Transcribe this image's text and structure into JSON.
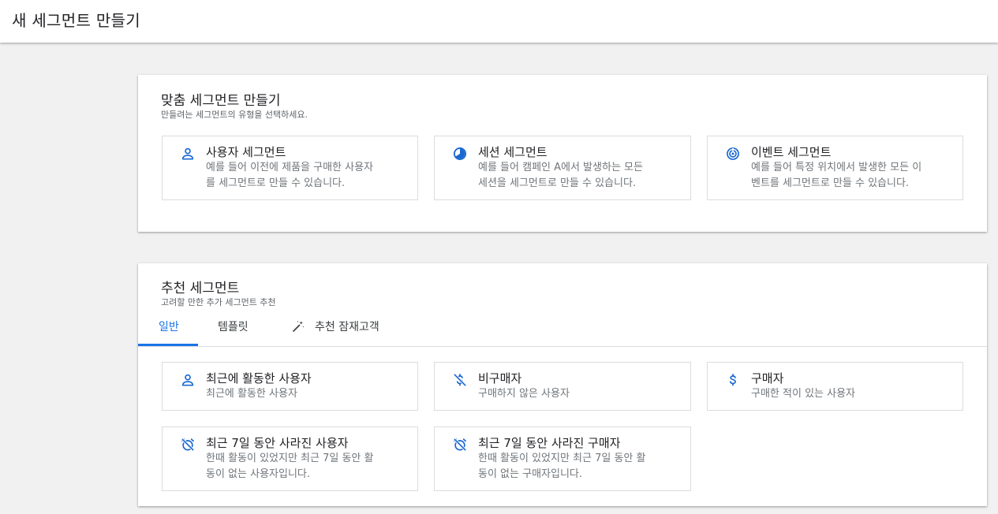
{
  "header": {
    "title": "새 세그먼트 만들기"
  },
  "custom": {
    "title": "맞춤 세그먼트 만들기",
    "subtitle": "만들려는 세그먼트의 유형을 선택하세요.",
    "options": [
      {
        "icon": "person-icon",
        "title": "사용자 세그먼트",
        "desc": "예를 들어 이전에 제품을 구매한 사용자\n를 세그먼트로 만들 수 있습니다."
      },
      {
        "icon": "session-icon",
        "title": "세션 세그먼트",
        "desc": "예를 들어 캠페인 A에서 발생하는 모든\n세션을 세그먼트로 만들 수 있습니다."
      },
      {
        "icon": "event-icon",
        "title": "이벤트 세그먼트",
        "desc": "예를 들어 특정 위치에서 발생한 모든 이\n벤트를 세그먼트로 만들 수 있습니다."
      }
    ]
  },
  "suggested": {
    "title": "추천 세그먼트",
    "subtitle": "고려할 만한 추가 세그먼트 추천",
    "tabs": [
      {
        "label": "일반",
        "active": true
      },
      {
        "label": "템플릿",
        "active": false
      },
      {
        "label": "추천 잠재고객",
        "active": false,
        "icon": "magic-wand-icon"
      }
    ],
    "options": [
      {
        "icon": "person-icon",
        "title": "최근에 활동한 사용자",
        "desc": "최근에 활동한 사용자"
      },
      {
        "icon": "no-dollar-icon",
        "title": "비구매자",
        "desc": "구매하지 않은 사용자"
      },
      {
        "icon": "dollar-icon",
        "title": "구매자",
        "desc": "구매한 적이 있는 사용자"
      },
      {
        "icon": "alarm-off-icon",
        "title": "최근 7일 동안 사라진 사용자",
        "desc": "한때 활동이 있었지만 최근 7일 동안 활\n동이 없는 사용자입니다."
      },
      {
        "icon": "alarm-off-icon",
        "title": "최근 7일 동안 사라진 구매자",
        "desc": "한때 활동이 있었지만 최근 7일 동안 활\n동이 없는 구매자입니다."
      }
    ]
  },
  "colors": {
    "accent": "#1a73e8",
    "icon": "#1967d2",
    "border": "#dadce0",
    "background": "#f1f1f1"
  }
}
